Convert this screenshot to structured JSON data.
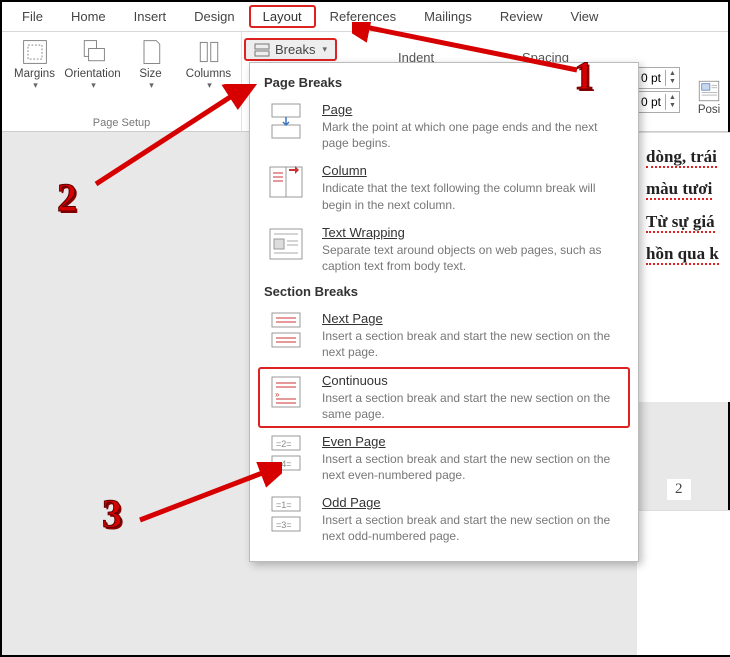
{
  "tabs": [
    "File",
    "Home",
    "Insert",
    "Design",
    "Layout",
    "References",
    "Mailings",
    "Review",
    "View"
  ],
  "active_tab": "Layout",
  "ribbon": {
    "page_setup": {
      "label": "Page Setup",
      "margins": "Margins",
      "orientation": "Orientation",
      "size": "Size",
      "columns": "Columns"
    },
    "breaks_label": "Breaks",
    "indent_label": "Indent",
    "spacing_label": "Spacing",
    "spacing_before": "0 pt",
    "spacing_after": "0 pt",
    "position_label": "Posi"
  },
  "dropdown": {
    "sec1_title": "Page Breaks",
    "page": {
      "name": "Page",
      "desc": "Mark the point at which one page ends and the next page begins."
    },
    "column": {
      "name": "Column",
      "desc": "Indicate that the text following the column break will begin in the next column."
    },
    "textwrap": {
      "name": "Text Wrapping",
      "desc": "Separate text around objects on web pages, such as caption text from body text."
    },
    "sec2_title": "Section Breaks",
    "nextpage": {
      "name": "Next Page",
      "desc": "Insert a section break and start the new section on the next page."
    },
    "continuous": {
      "name": "Continuous",
      "desc": "Insert a section break and start the new section on the same page."
    },
    "evenpage": {
      "name": "Even Page",
      "desc": "Insert a section break and start the new section on the next even-numbered page."
    },
    "oddpage": {
      "name": "Odd Page",
      "desc": "Insert a section break and start the new section on the next odd-numbered page."
    }
  },
  "doc": {
    "line1": "dòng, trái",
    "line2": "màu tươi",
    "line3": "Từ sự giá",
    "line4": "hồn qua k",
    "page_number": "2"
  },
  "annotations": {
    "a1": "1",
    "a2": "2",
    "a3": "3"
  }
}
